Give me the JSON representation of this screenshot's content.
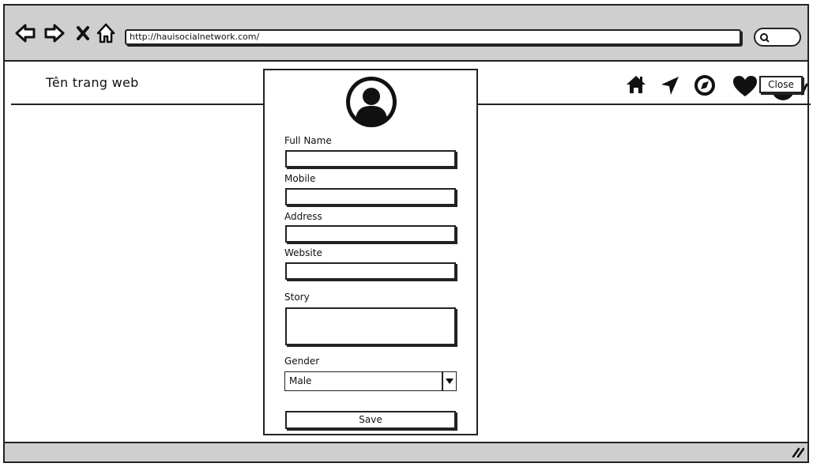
{
  "browser": {
    "url": "http://hauisocialnetwork.com/",
    "nav_icons": [
      "back-icon",
      "forward-icon",
      "stop-icon",
      "home-icon"
    ],
    "search_icon": "search-icon"
  },
  "header": {
    "site_title": "Tên trang web",
    "icons": [
      "home-icon",
      "location-arrow-icon",
      "compass-icon",
      "heart-icon",
      "profile-icon"
    ],
    "close_label": "Close"
  },
  "form": {
    "avatar_icon": "user-avatar-icon",
    "fields": {
      "full_name": {
        "label": "Full Name",
        "value": ""
      },
      "mobile": {
        "label": "Mobile",
        "value": ""
      },
      "address": {
        "label": "Address",
        "value": ""
      },
      "website": {
        "label": "Website",
        "value": ""
      },
      "story": {
        "label": "Story",
        "value": ""
      }
    },
    "gender": {
      "label": "Gender",
      "value": "Male"
    },
    "save_label": "Save"
  },
  "footer": {
    "resize_icon": "resize-grip-icon"
  }
}
